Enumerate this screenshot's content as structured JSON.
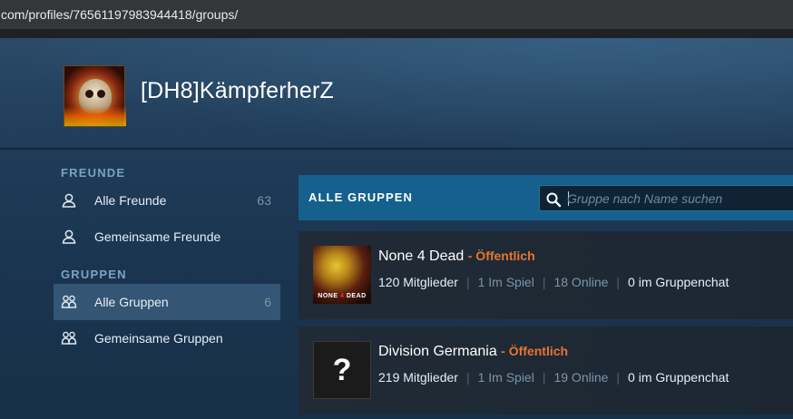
{
  "browser": {
    "url": "com/profiles/76561197983944418/groups/"
  },
  "profile": {
    "username": "[DH8]KämpferherZ"
  },
  "sidebar": {
    "friends_heading": "FREUNDE",
    "groups_heading": "GRUPPEN",
    "items": [
      {
        "label": "Alle Freunde",
        "count": "63",
        "icon": "person-icon"
      },
      {
        "label": "Gemeinsame Freunde",
        "count": "",
        "icon": "person-icon"
      },
      {
        "label": "Alle Gruppen",
        "count": "6",
        "icon": "group-icon",
        "active": true
      },
      {
        "label": "Gemeinsame Gruppen",
        "count": "",
        "icon": "group-icon"
      }
    ]
  },
  "main": {
    "title": "ALLE GRUPPEN",
    "search_placeholder": "Gruppe nach Name suchen",
    "groups": [
      {
        "name": "None 4 Dead",
        "visibility": "- Öffentlich",
        "members": "120 Mitglieder",
        "in_game": "1 Im Spiel",
        "online": "18 Online",
        "chat": "0 im Gruppenchat",
        "thumb_text_a": "NONE",
        "thumb_text_b": "4",
        "thumb_text_c": "DEAD"
      },
      {
        "name": "Division Germania",
        "visibility": "- Öffentlich",
        "members": "219 Mitglieder",
        "in_game": "1 Im Spiel",
        "online": "19 Online",
        "chat": "0 im Gruppenchat",
        "thumb_text": "?"
      }
    ]
  },
  "colors": {
    "accent_bar": "#15608c",
    "public_label": "#e57532",
    "heading": "#7aa3c3"
  }
}
